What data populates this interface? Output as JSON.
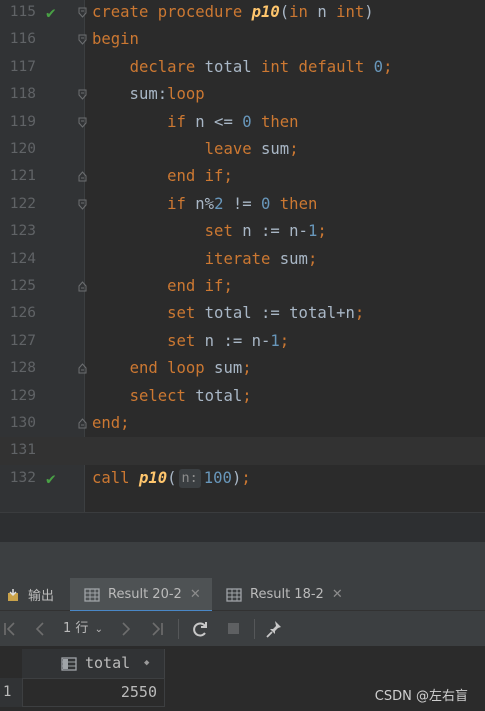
{
  "editor": {
    "lines": [
      {
        "no": "115",
        "check": true,
        "current": false,
        "fold": "open",
        "segments": [
          {
            "t": "create procedure ",
            "c": "kw"
          },
          {
            "t": "p10",
            "c": "fn"
          },
          {
            "t": "(",
            "c": ""
          },
          {
            "t": "in",
            "c": "kw"
          },
          {
            "t": " n ",
            "c": ""
          },
          {
            "t": "int",
            "c": "kw"
          },
          {
            "t": ")",
            "c": ""
          }
        ]
      },
      {
        "no": "116",
        "check": false,
        "current": false,
        "fold": "open",
        "segments": [
          {
            "t": "begin",
            "c": "kw"
          }
        ]
      },
      {
        "no": "117",
        "check": false,
        "current": false,
        "fold": "",
        "segments": [
          {
            "t": "    ",
            "c": ""
          },
          {
            "t": "declare",
            "c": "kw"
          },
          {
            "t": " total ",
            "c": ""
          },
          {
            "t": "int default ",
            "c": "kw"
          },
          {
            "t": "0",
            "c": "num"
          },
          {
            "t": ";",
            "c": "kw"
          }
        ]
      },
      {
        "no": "118",
        "check": false,
        "current": false,
        "fold": "open",
        "segments": [
          {
            "t": "    sum:",
            "c": ""
          },
          {
            "t": "loop",
            "c": "kw"
          }
        ]
      },
      {
        "no": "119",
        "check": false,
        "current": false,
        "fold": "open",
        "segments": [
          {
            "t": "        ",
            "c": ""
          },
          {
            "t": "if",
            "c": "kw"
          },
          {
            "t": " n <= ",
            "c": ""
          },
          {
            "t": "0",
            "c": "num"
          },
          {
            "t": " ",
            "c": ""
          },
          {
            "t": "then",
            "c": "kw"
          }
        ]
      },
      {
        "no": "120",
        "check": false,
        "current": false,
        "fold": "",
        "segments": [
          {
            "t": "            ",
            "c": ""
          },
          {
            "t": "leave",
            "c": "kw"
          },
          {
            "t": " sum",
            "c": ""
          },
          {
            "t": ";",
            "c": "kw"
          }
        ]
      },
      {
        "no": "121",
        "check": false,
        "current": false,
        "fold": "close",
        "segments": [
          {
            "t": "        ",
            "c": ""
          },
          {
            "t": "end if",
            "c": "kw"
          },
          {
            "t": ";",
            "c": "kw"
          }
        ]
      },
      {
        "no": "122",
        "check": false,
        "current": false,
        "fold": "open",
        "segments": [
          {
            "t": "        ",
            "c": ""
          },
          {
            "t": "if",
            "c": "kw"
          },
          {
            "t": " n%",
            "c": ""
          },
          {
            "t": "2",
            "c": "num"
          },
          {
            "t": " != ",
            "c": ""
          },
          {
            "t": "0",
            "c": "num"
          },
          {
            "t": " ",
            "c": ""
          },
          {
            "t": "then",
            "c": "kw"
          }
        ]
      },
      {
        "no": "123",
        "check": false,
        "current": false,
        "fold": "",
        "segments": [
          {
            "t": "            ",
            "c": ""
          },
          {
            "t": "set",
            "c": "kw"
          },
          {
            "t": " n := n-",
            "c": ""
          },
          {
            "t": "1",
            "c": "num"
          },
          {
            "t": ";",
            "c": "kw"
          }
        ]
      },
      {
        "no": "124",
        "check": false,
        "current": false,
        "fold": "",
        "segments": [
          {
            "t": "            ",
            "c": ""
          },
          {
            "t": "iterate",
            "c": "kw"
          },
          {
            "t": " sum",
            "c": ""
          },
          {
            "t": ";",
            "c": "kw"
          }
        ]
      },
      {
        "no": "125",
        "check": false,
        "current": false,
        "fold": "close",
        "segments": [
          {
            "t": "        ",
            "c": ""
          },
          {
            "t": "end if",
            "c": "kw"
          },
          {
            "t": ";",
            "c": "kw"
          }
        ]
      },
      {
        "no": "126",
        "check": false,
        "current": false,
        "fold": "",
        "segments": [
          {
            "t": "        ",
            "c": ""
          },
          {
            "t": "set",
            "c": "kw"
          },
          {
            "t": " total := total+n",
            "c": ""
          },
          {
            "t": ";",
            "c": "kw"
          }
        ]
      },
      {
        "no": "127",
        "check": false,
        "current": false,
        "fold": "",
        "segments": [
          {
            "t": "        ",
            "c": ""
          },
          {
            "t": "set",
            "c": "kw"
          },
          {
            "t": " n := n-",
            "c": ""
          },
          {
            "t": "1",
            "c": "num"
          },
          {
            "t": ";",
            "c": "kw"
          }
        ]
      },
      {
        "no": "128",
        "check": false,
        "current": false,
        "fold": "close",
        "segments": [
          {
            "t": "    ",
            "c": ""
          },
          {
            "t": "end loop",
            "c": "kw"
          },
          {
            "t": " sum",
            "c": ""
          },
          {
            "t": ";",
            "c": "kw"
          }
        ]
      },
      {
        "no": "129",
        "check": false,
        "current": false,
        "fold": "",
        "segments": [
          {
            "t": "    ",
            "c": ""
          },
          {
            "t": "select",
            "c": "kw"
          },
          {
            "t": " total",
            "c": ""
          },
          {
            "t": ";",
            "c": "kw"
          }
        ]
      },
      {
        "no": "130",
        "check": false,
        "current": false,
        "fold": "close",
        "segments": [
          {
            "t": "end",
            "c": "kw"
          },
          {
            "t": ";",
            "c": "kw"
          }
        ]
      },
      {
        "no": "131",
        "check": false,
        "current": true,
        "fold": "",
        "segments": []
      },
      {
        "no": "132",
        "check": true,
        "current": false,
        "fold": "",
        "segments": [
          {
            "t": "call ",
            "c": "kw"
          },
          {
            "t": "p10",
            "c": "fn"
          },
          {
            "t": "(",
            "c": ""
          },
          {
            "t": "n:",
            "c": "hint"
          },
          {
            "t": "100",
            "c": "num"
          },
          {
            "t": ")",
            "c": ""
          },
          {
            "t": ";",
            "c": "kw"
          }
        ]
      }
    ]
  },
  "tabs": [
    {
      "label": "输出",
      "icon": "output-icon",
      "active": false,
      "closable": false
    },
    {
      "label": "Result 20-2",
      "icon": "table-icon",
      "active": true,
      "closable": true
    },
    {
      "label": "Result 18-2",
      "icon": "table-icon",
      "active": false,
      "closable": true
    }
  ],
  "toolbar": {
    "first": "|<",
    "prev": "<",
    "page_label": "1 行",
    "next": ">",
    "last": ">|",
    "refresh": "⟳",
    "stop": "■",
    "pin": "📌"
  },
  "grid": {
    "column": "total",
    "sort_marker": "◆",
    "row_number": "1",
    "value": "2550"
  },
  "watermark": "CSDN @左右盲",
  "colors": {
    "keyword": "#cc7832",
    "function": "#ffc66d",
    "number": "#6897bb",
    "identifier": "#a9b7c6",
    "check": "#49a145",
    "tab_underline": "#4a88c7"
  }
}
